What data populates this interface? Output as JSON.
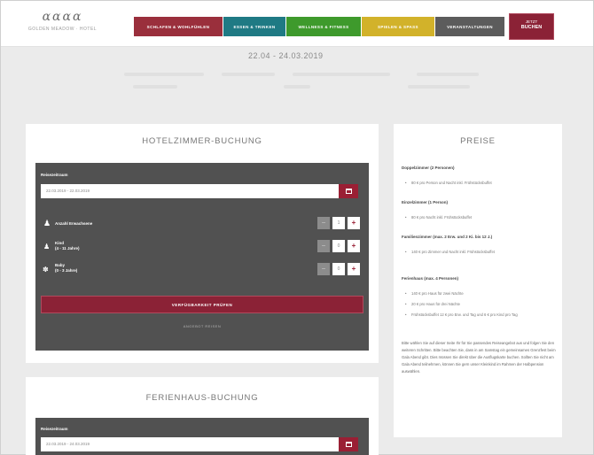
{
  "header": {
    "logo_mark": "ɑɑɑɑ",
    "logo_text": "GOLDEN MEADOW · HOTEL",
    "nav": [
      {
        "label": "SCHLAFEN & WOHLFÜHLEN",
        "color": "#9a2f3c"
      },
      {
        "label": "ESSEN & TRINKEN",
        "color": "#1f7a84"
      },
      {
        "label": "WELLNESS & FITNESS",
        "color": "#3e9a2c"
      },
      {
        "label": "SPIELEN & SPASS",
        "color": "#d2b22a"
      },
      {
        "label": "VERANSTALTUNGEN",
        "color": "#5c5c5c"
      }
    ],
    "book_line1": "JETZT",
    "book_line2": "BUCHEN"
  },
  "date_range": "22.04 - 24.03.2019",
  "hotel": {
    "title": "HOTELZIMMER-BUCHUNG",
    "date_label": "Reisezeitraum",
    "date_value": "22.03.2019 - 22.03.2019",
    "guests": [
      {
        "label": "Anzahl Erwachsene",
        "sub": "",
        "value": "1",
        "icon": "adult-icon"
      },
      {
        "label": "Kind",
        "sub": "(4 - 11 Jahre)",
        "value": "0",
        "icon": "child-icon"
      },
      {
        "label": "Baby",
        "sub": "(0 - 3 Jahre)",
        "value": "0",
        "icon": "baby-icon"
      }
    ],
    "minus": "−",
    "plus": "+",
    "check_button": "VERFÜGBARKEIT PRÜFEN",
    "reset_link": "ANGEBOT REISEN"
  },
  "prices": {
    "title": "PREISE",
    "sections": [
      {
        "heading": "Doppelzimmer (2 Personen)",
        "items": [
          "80 € pro Person und Nacht inkl. Frühstücksbuffet"
        ]
      },
      {
        "heading": "Einzelzimmer (1 Person)",
        "items": [
          "80 € pro Nacht inkl. Frühstücksbuffet"
        ]
      },
      {
        "heading": "Familienzimmer (max. 2 Erw. und 2 Ki. bis 12 J.)",
        "items": [
          "140 € pro Zimmer und Nacht inkl. Frühstücksbuffet"
        ]
      },
      {
        "heading": "Ferienhaus (max. 4 Personen)",
        "items": [
          "140 € pro Haus für zwei Nächte",
          "20 € pro Haus für drei Nächte",
          "Frühstücksbuffet 12 € pro Erw. und Tag und 6 € pro Kind pro Tag"
        ]
      }
    ],
    "note": "Bitte wählen Sie auf dieser Seite Ihr für Sie passendes Reiseangebot aus und folgen Sie den weiteren Schritten. Bitte beachten Sie, dass in am Samstag ein gemeinsames Grenzfest beim Gala Abend gibt. Dies müssen Sie direkt über die Ausflugskarte buchen. Sollten Sie nicht am Gala Abend teilnehmen, können Sie gern unser Kleinkind im Rahmen der Halbpension auswählen."
  },
  "house": {
    "title": "FERIENHAUS-BUCHUNG",
    "date_label": "Reisezeitraum",
    "date_value": "22.03.2019 - 24.03.2019"
  }
}
